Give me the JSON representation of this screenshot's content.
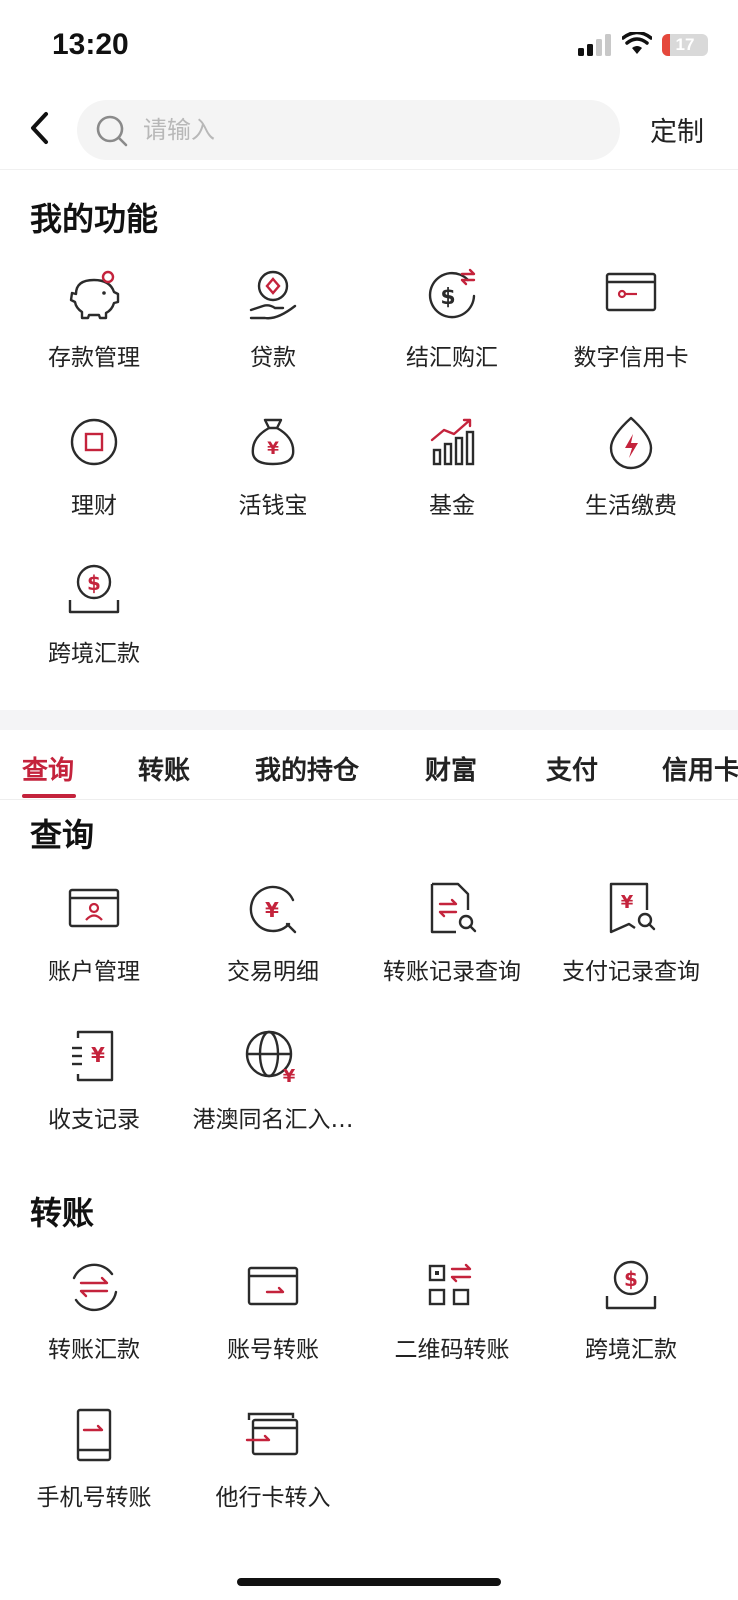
{
  "status_bar": {
    "time": "13:20",
    "battery": "17",
    "battery_level": 0.17
  },
  "header": {
    "back_icon": "chevron-left-icon",
    "search_icon": "search-icon",
    "search_placeholder": "请输入",
    "customize_label": "定制"
  },
  "my_functions": {
    "title": "我的功能",
    "items": [
      {
        "label": "存款管理",
        "icon": "piggy-bank-icon"
      },
      {
        "label": "贷款",
        "icon": "loan-hand-icon"
      },
      {
        "label": "结汇购汇",
        "icon": "currency-exchange-icon"
      },
      {
        "label": "数字信用卡",
        "icon": "credit-card-icon"
      },
      {
        "label": "理财",
        "icon": "wealth-icon"
      },
      {
        "label": "活钱宝",
        "icon": "money-bag-icon"
      },
      {
        "label": "基金",
        "icon": "fund-chart-icon"
      },
      {
        "label": "生活缴费",
        "icon": "utility-bill-icon"
      },
      {
        "label": "跨境汇款",
        "icon": "cross-border-remit-icon"
      }
    ]
  },
  "tabs": [
    {
      "label": "查询",
      "active": true
    },
    {
      "label": "转账",
      "active": false
    },
    {
      "label": "我的持仓",
      "active": false
    },
    {
      "label": "财富",
      "active": false
    },
    {
      "label": "支付",
      "active": false
    },
    {
      "label": "信用卡",
      "active": false
    }
  ],
  "query_section": {
    "title": "查询",
    "items": [
      {
        "label": "账户管理",
        "icon": "account-card-icon"
      },
      {
        "label": "交易明细",
        "icon": "transaction-detail-icon"
      },
      {
        "label": "转账记录查询",
        "icon": "transfer-record-icon"
      },
      {
        "label": "支付记录查询",
        "icon": "payment-record-icon"
      },
      {
        "label": "收支记录",
        "icon": "income-expense-icon"
      },
      {
        "label": "港澳同名汇入…",
        "icon": "globe-yen-icon"
      }
    ]
  },
  "transfer_section": {
    "title": "转账",
    "items": [
      {
        "label": "转账汇款",
        "icon": "transfer-remit-icon"
      },
      {
        "label": "账号转账",
        "icon": "account-transfer-icon"
      },
      {
        "label": "二维码转账",
        "icon": "qr-transfer-icon"
      },
      {
        "label": "跨境汇款",
        "icon": "cross-border-remit-icon"
      },
      {
        "label": "手机号转账",
        "icon": "phone-transfer-icon"
      },
      {
        "label": "他行卡转入",
        "icon": "other-bank-card-icon"
      }
    ]
  },
  "colors": {
    "accent": "#c4233c",
    "icon_stroke": "#2b2b2b"
  }
}
